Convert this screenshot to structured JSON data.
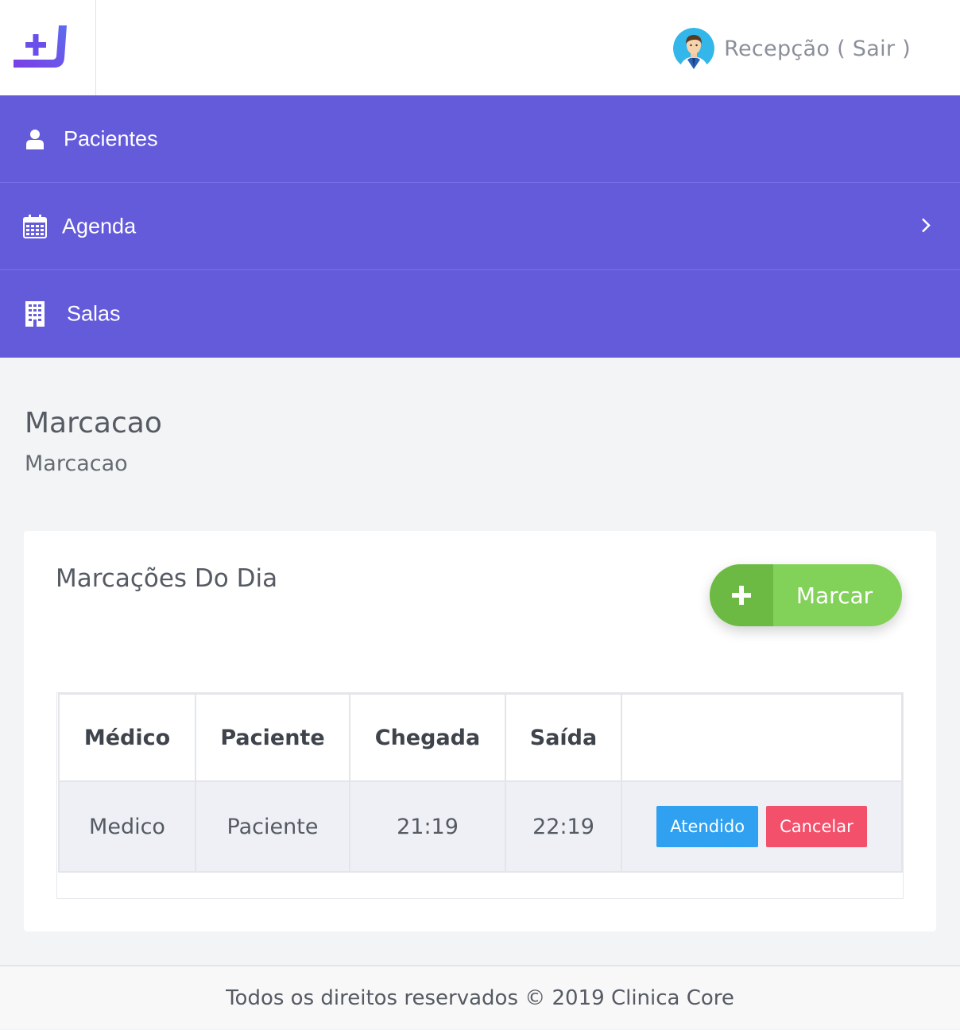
{
  "header": {
    "logo_icon": "clinic-plus-logo-icon",
    "user_label": "Recepção ( Sair )",
    "avatar_icon": "doctor-avatar-icon"
  },
  "nav": {
    "items": [
      {
        "label": "Pacientes",
        "icon": "user-icon"
      },
      {
        "label": "Agenda",
        "icon": "calendar-icon",
        "has_chevron": true
      },
      {
        "label": "Salas",
        "icon": "building-icon"
      }
    ],
    "color": "#645bdb"
  },
  "page": {
    "title": "Marcacao",
    "subtitle": "Marcacao"
  },
  "card": {
    "title": "Marcações Do Dia",
    "add_button_label": "Marcar",
    "table": {
      "headers": [
        "Médico",
        "Paciente",
        "Chegada",
        "Saída",
        ""
      ],
      "rows": [
        {
          "medico": "Medico",
          "paciente": "Paciente",
          "chegada": "21:19",
          "saida": "22:19",
          "actions": [
            "Atendido",
            "Cancelar"
          ]
        }
      ]
    }
  },
  "colors": {
    "accent": "#645bdb",
    "success": "#82d158",
    "info": "#2fa1f0",
    "danger": "#f2506b"
  },
  "footer": {
    "text": "Todos os direitos reservados © 2019 Clinica Core"
  }
}
